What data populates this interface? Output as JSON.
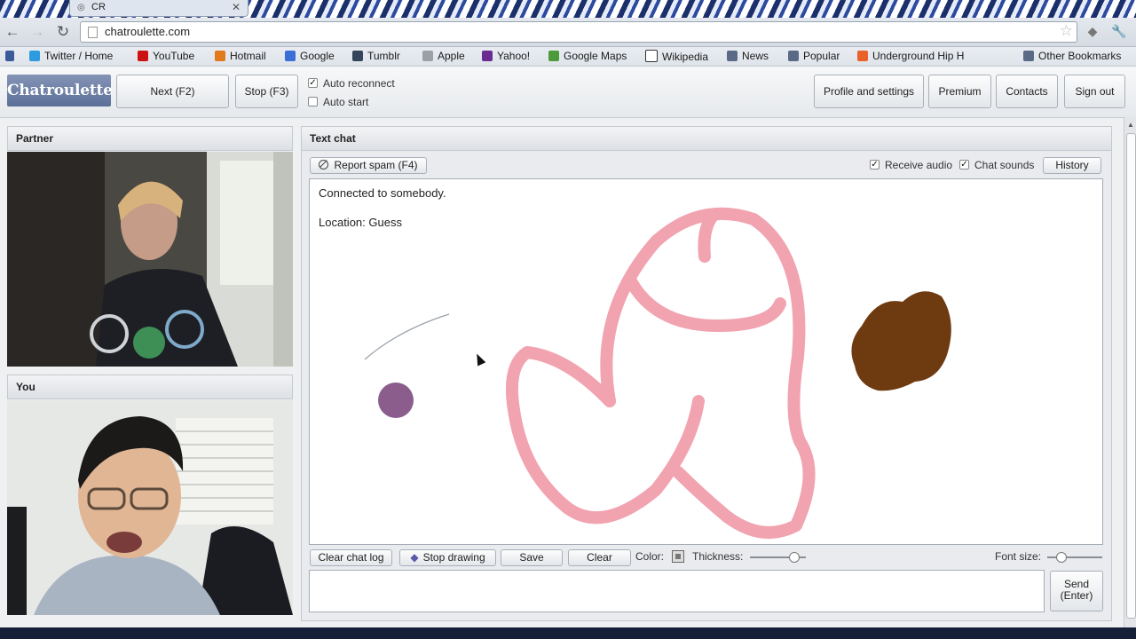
{
  "browser": {
    "tab_title": "CR",
    "url": "chatroulette.com",
    "bookmarks": [
      {
        "label": "Twitter / Home",
        "color": "#2d9be0"
      },
      {
        "label": "YouTube",
        "color": "#cc1111"
      },
      {
        "label": "Hotmail",
        "color": "#e07a1c"
      },
      {
        "label": "Google",
        "color": "#3a6fd8"
      },
      {
        "label": "Tumblr",
        "color": "#35465c"
      },
      {
        "label": "Apple",
        "color": "#9aa0a6"
      },
      {
        "label": "Yahoo!",
        "color": "#6b2c91"
      },
      {
        "label": "Google Maps",
        "color": "#4c9a3a"
      },
      {
        "label": "Wikipedia",
        "color": "#333333"
      },
      {
        "label": "News",
        "color": "#5a6a86"
      },
      {
        "label": "Popular",
        "color": "#5a6a86"
      },
      {
        "label": "Underground Hip H",
        "color": "#e8622a"
      }
    ],
    "other_bookmarks": "Other Bookmarks"
  },
  "header": {
    "logo": "Chatroulette",
    "next_label": "Next (F2)",
    "stop_label": "Stop (F3)",
    "auto_reconnect": {
      "label": "Auto reconnect",
      "checked": true
    },
    "auto_start": {
      "label": "Auto start",
      "checked": false
    },
    "profile_label": "Profile and settings",
    "premium_label": "Premium",
    "contacts_label": "Contacts",
    "signout_label": "Sign out"
  },
  "partner": {
    "title": "Partner"
  },
  "you": {
    "title": "You"
  },
  "chat": {
    "title": "Text chat",
    "report_label": "Report spam (F4)",
    "receive_audio": {
      "label": "Receive audio",
      "checked": true
    },
    "chat_sounds": {
      "label": "Chat sounds",
      "checked": true
    },
    "history_label": "History",
    "messages": [
      "Connected to somebody.",
      "Location: Guess"
    ],
    "clear_log_label": "Clear chat log",
    "stop_drawing_label": "Stop drawing",
    "save_label": "Save",
    "clear_label": "Clear",
    "color_label": "Color:",
    "thickness_label": "Thickness:",
    "thickness_value": 0.8,
    "font_size_label": "Font size:",
    "font_size_value": 0.25,
    "send_label_1": "Send",
    "send_label_2": "(Enter)",
    "drawing_colors": {
      "pink": "#f1a3b0",
      "brown": "#6e3a10",
      "purple": "#8a5d8d",
      "gray": "#9aa0a8"
    }
  }
}
